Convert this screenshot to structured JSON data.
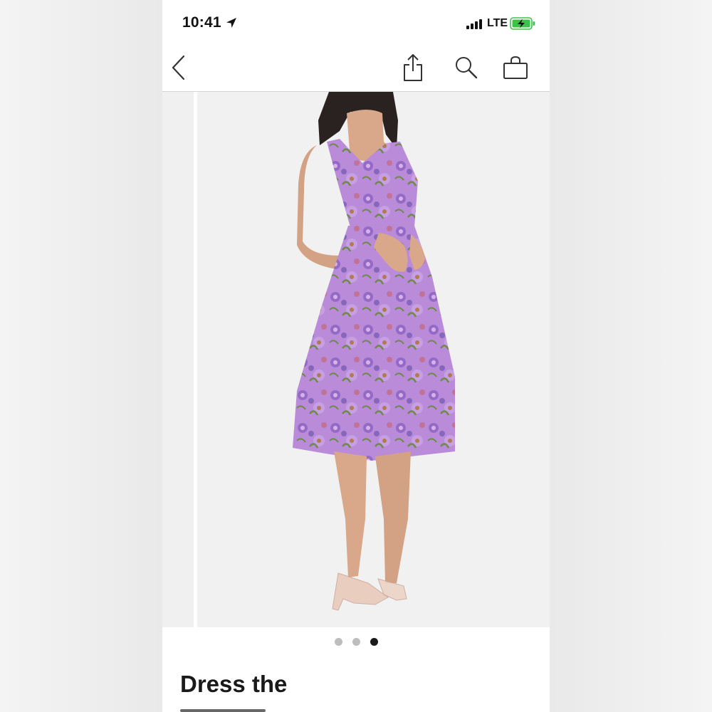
{
  "status_bar": {
    "time": "10:41",
    "network": "LTE",
    "battery_color": "#3cc24a"
  },
  "nav": {
    "icons": [
      "chevron-left-icon",
      "share-icon",
      "search-icon",
      "shopping-bag-icon"
    ]
  },
  "gallery": {
    "image": "product photo: model in lavender floral embroidered midi dress",
    "dress_color": "#b88ad8",
    "total_images": 3,
    "active_index": 3
  },
  "product": {
    "title": "Dress the"
  }
}
